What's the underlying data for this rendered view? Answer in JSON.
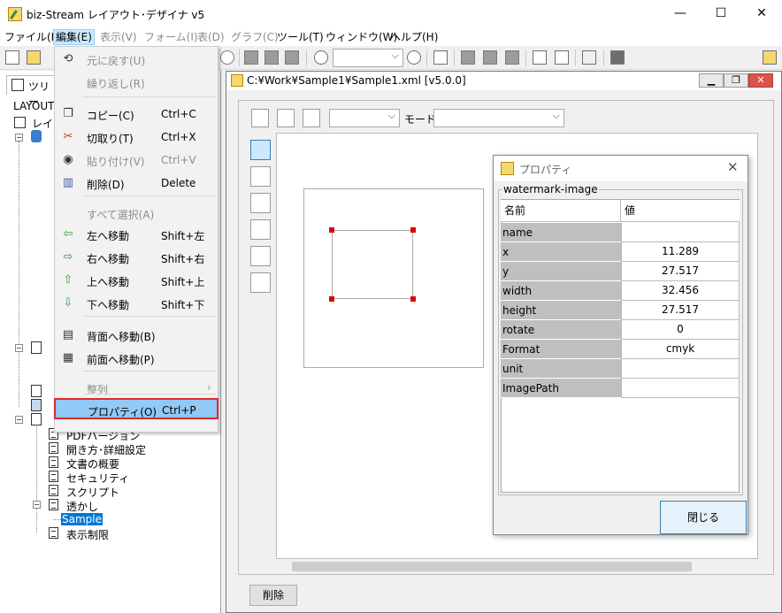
{
  "window": {
    "title": "biz-Stream レイアウト･デザイナ v5",
    "minimize": "—",
    "maximize": "☐",
    "close": "✕"
  },
  "menubar": [
    {
      "label": "ファイル(F)"
    },
    {
      "label": "編集(E)"
    },
    {
      "label": "表示(V)"
    },
    {
      "label": "フォーム(I)"
    },
    {
      "label": "表(D)"
    },
    {
      "label": "グラフ(C)"
    },
    {
      "label": "ツール(T)"
    },
    {
      "label": "ウィンドウ(W)"
    },
    {
      "label": "ヘルプ(H)"
    }
  ],
  "edit_menu": [
    {
      "label": "元に戻す(U)",
      "shortcut": "",
      "disabled": true
    },
    {
      "label": "繰り返し(R)",
      "shortcut": "",
      "disabled": true
    },
    {
      "label": "コピー(C)",
      "shortcut": "Ctrl+C",
      "disabled": false
    },
    {
      "label": "切取り(T)",
      "shortcut": "Ctrl+X",
      "disabled": false
    },
    {
      "label": "貼り付け(V)",
      "shortcut": "Ctrl+V",
      "disabled": true
    },
    {
      "label": "削除(D)",
      "shortcut": "Delete",
      "disabled": false
    },
    {
      "label": "すべて選択(A)",
      "shortcut": "",
      "disabled": true
    },
    {
      "label": "左へ移動",
      "shortcut": "Shift+左",
      "disabled": false
    },
    {
      "label": "右へ移動",
      "shortcut": "Shift+右",
      "disabled": false
    },
    {
      "label": "上へ移動",
      "shortcut": "Shift+上",
      "disabled": false
    },
    {
      "label": "下へ移動",
      "shortcut": "Shift+下",
      "disabled": false
    },
    {
      "label": "背面へ移動(B)",
      "shortcut": "",
      "disabled": false
    },
    {
      "label": "前面へ移動(P)",
      "shortcut": "",
      "disabled": false
    },
    {
      "label": "整列",
      "shortcut": "",
      "disabled": true
    },
    {
      "label": "プロパティ(O)",
      "shortcut": "Ctrl+P",
      "disabled": false
    }
  ],
  "left_panel": {
    "tab_label": "ツリー",
    "root_label": "LAYOUT",
    "layout_label": "レイア",
    "tree_items": [
      {
        "label": "PDFバージョン"
      },
      {
        "label": "開き方･詳細設定"
      },
      {
        "label": "文書の概要"
      },
      {
        "label": "セキュリティ"
      },
      {
        "label": "スクリプト"
      },
      {
        "label": "透かし"
      },
      {
        "label": "Sample",
        "selected": true
      },
      {
        "label": "表示制限"
      }
    ]
  },
  "document": {
    "title": "C:¥Work¥Sample1¥Sample1.xml [v5.0.0]",
    "mode_label": "モード",
    "delete_button": "削除"
  },
  "properties": {
    "title": "プロパティ",
    "group_label": "watermark-image",
    "header_name": "名前",
    "header_value": "値",
    "rows": [
      {
        "name": "name",
        "value": ""
      },
      {
        "name": "x",
        "value": "11.289"
      },
      {
        "name": "y",
        "value": "27.517"
      },
      {
        "name": "width",
        "value": "32.456"
      },
      {
        "name": "height",
        "value": "27.517"
      },
      {
        "name": "rotate",
        "value": "0"
      },
      {
        "name": "Format",
        "value": "cmyk"
      },
      {
        "name": "unit",
        "value": ""
      },
      {
        "name": "ImagePath",
        "value": ""
      }
    ],
    "close_button": "閉じる"
  },
  "colors": {
    "highlight": "#91c9f7",
    "highlight_border": "#e02b2b",
    "selection": "#0078d7",
    "handle": "#e00000"
  }
}
